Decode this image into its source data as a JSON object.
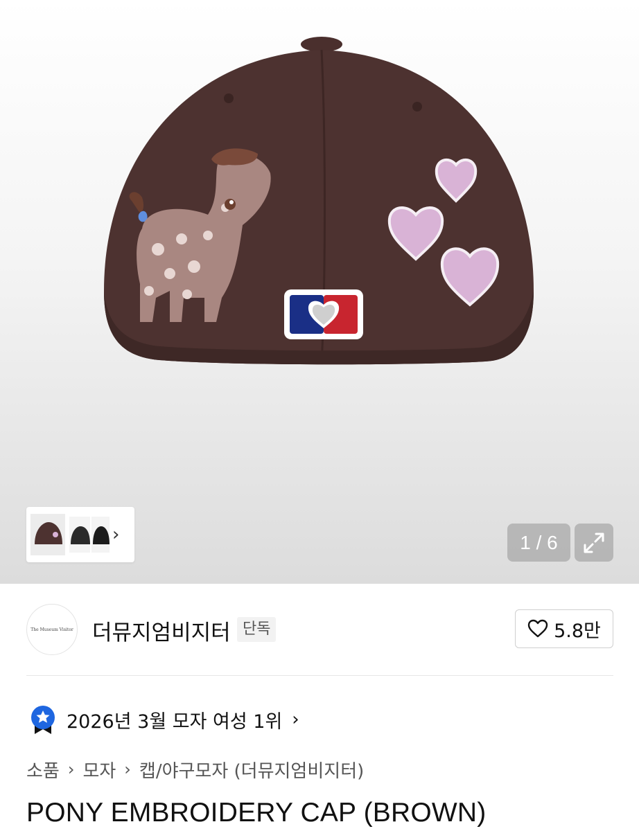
{
  "gallery": {
    "counter": "1 / 6",
    "thumbnails": [
      "cap-back-thumb",
      "cap-side-thumb",
      "cap-detail-thumb"
    ],
    "icons": {
      "next": "chevron-right-icon",
      "expand": "expand-icon"
    }
  },
  "seller": {
    "logo_text": "The Museum Visitor",
    "name": "더뮤지엄비지터",
    "badge": "단독",
    "like_count": "5.8만"
  },
  "ranking": {
    "text": "2026년 3월 모자 여성 1위",
    "icon": "ranking-medal-icon"
  },
  "breadcrumb": {
    "items": [
      "소품",
      "모자",
      "캡/야구모자 (더뮤지엄비지터)"
    ]
  },
  "product": {
    "title": "PONY EMBROIDERY CAP (BROWN)"
  },
  "colors": {
    "cap_brown": "#4d3230",
    "accent_heart_pink": "#d9b3d6",
    "badge_blue": "#1e66e0"
  }
}
